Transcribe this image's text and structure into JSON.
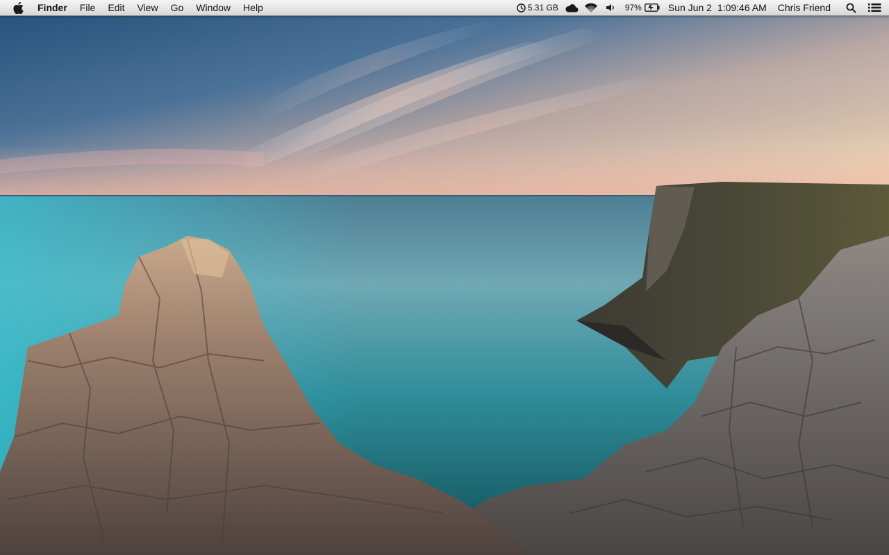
{
  "menubar": {
    "apple_icon": "apple-logo",
    "app_name": "Finder",
    "menus": [
      "File",
      "Edit",
      "View",
      "Go",
      "Window",
      "Help"
    ],
    "status": {
      "disk_space": "5.31 GB",
      "disk_icon": "clock-disk-icon",
      "cloud_icon": "cloud-icon",
      "wifi_icon": "wifi-icon",
      "volume_icon": "speaker-icon",
      "battery_percent": "97%",
      "battery_icon": "battery-charging-icon",
      "date": "Sun Jun 2",
      "time": "1:09:46 AM",
      "user_name": "Chris Friend",
      "spotlight_icon": "search-icon",
      "notifications_icon": "list-icon"
    }
  },
  "colors": {
    "menubar_top": "#f4f4f4",
    "menubar_bottom": "#d6d6d6",
    "sky_top": "#2f5f8c",
    "sky_horizon": "#f3d9b5",
    "sea": "#3fa3ae",
    "cliff": "#6b6460"
  }
}
